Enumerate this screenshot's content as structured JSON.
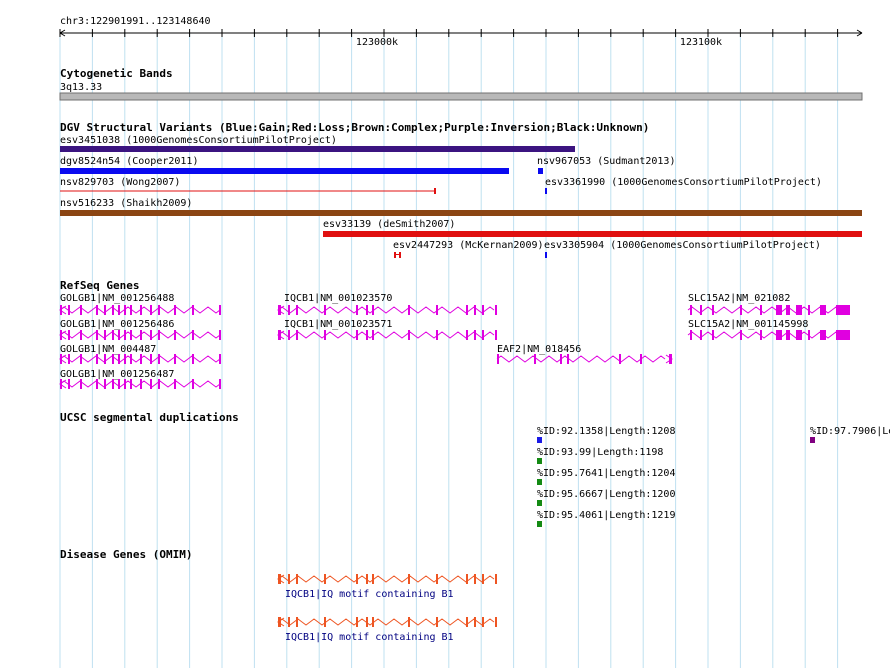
{
  "header": {
    "location": "chr3:122901991..123148640"
  },
  "ruler": {
    "ticks": [
      {
        "label": "123000k",
        "value": 123000000
      },
      {
        "label": "123100k",
        "value": 123100000
      }
    ]
  },
  "tracks": {
    "cyto": {
      "title": "Cytogenetic Bands",
      "band": "3q13.33"
    },
    "dgv": {
      "title": "DGV Structural Variants (Blue:Gain;Red:Loss;Brown:Complex;Purple:Inversion;Black:Unknown)",
      "items": [
        {
          "label": "esv3451038 (1000GenomesConsortiumPilotProject)",
          "color": "#3b1480"
        },
        {
          "label": "dgv8524n54 (Cooper2011)",
          "color": "#0a0af0"
        },
        {
          "label": "nsv967053 (Sudmant2013)",
          "color": "#0a0af0"
        },
        {
          "label": "esv3361990 (1000GenomesConsortiumPilotProject)",
          "color": "#0a0af0"
        },
        {
          "label": "nsv829703 (Wong2007)",
          "color": "#e01010"
        },
        {
          "label": "nsv516233 (Shaikh2009)",
          "color": "#8b4513"
        },
        {
          "label": "esv33139 (deSmith2007)",
          "color": "#e01010"
        },
        {
          "label": "esv2447293 (McKernan2009)",
          "color": "#e01010"
        },
        {
          "label": "esv3305904 (1000GenomesConsortiumPilotProject)",
          "color": "#0a0af0"
        }
      ]
    },
    "refseq": {
      "title": "RefSeq Genes",
      "color": "#e000e0",
      "genes": [
        {
          "label": "GOLGB1|NM_001256488"
        },
        {
          "label": "GOLGB1|NM_001256486"
        },
        {
          "label": "GOLGB1|NM_004487"
        },
        {
          "label": "GOLGB1|NM_001256487"
        },
        {
          "label": "IQCB1|NM_001023570"
        },
        {
          "label": "IQCB1|NM_001023571"
        },
        {
          "label": "EAF2|NM_018456"
        },
        {
          "label": "SLC15A2|NM_021082"
        },
        {
          "label": "SLC15A2|NM_001145998"
        }
      ]
    },
    "segdup": {
      "title": "UCSC segmental duplications",
      "items": [
        {
          "label": "%ID:92.1358|Length:1208",
          "color": "#1a1ae6"
        },
        {
          "label": "%ID:93.99|Length:1198",
          "color": "#138a13"
        },
        {
          "label": "%ID:95.7641|Length:1204",
          "color": "#138a13"
        },
        {
          "label": "%ID:95.6667|Length:1200",
          "color": "#138a13"
        },
        {
          "label": "%ID:95.4061|Length:1219",
          "color": "#138a13"
        },
        {
          "label": "%ID:97.7906|Le",
          "color": "#800080"
        }
      ]
    },
    "omim": {
      "title": "Disease Genes (OMIM)",
      "color": "#ee5522",
      "label_color": "#000080",
      "items": [
        {
          "label": "IQCB1|IQ motif containing B1"
        },
        {
          "label": "IQCB1|IQ motif containing B1"
        }
      ]
    }
  }
}
